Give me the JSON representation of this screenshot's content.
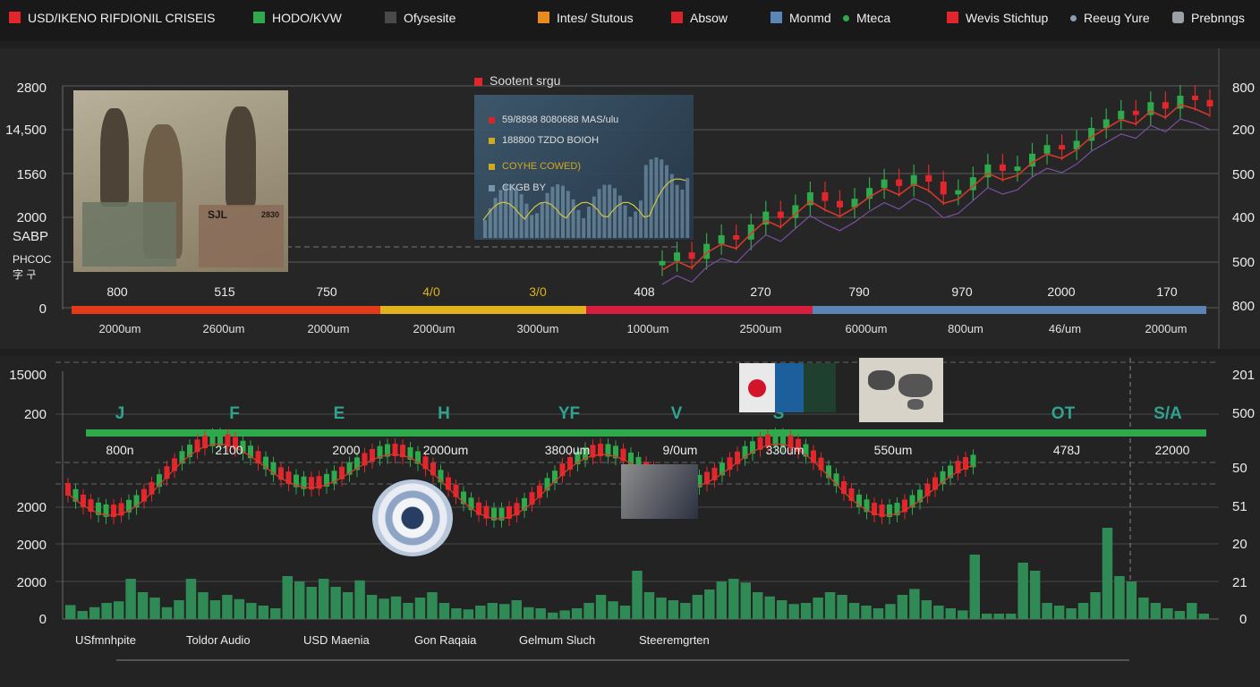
{
  "legend": [
    {
      "label": "USD/IKENO RIFDIONIL CRISEIS",
      "color": "#e3262b",
      "shape": "square"
    },
    {
      "label": "HODO/KVW",
      "color": "#2eaa4c",
      "shape": "square"
    },
    {
      "label": "Ofysesite",
      "color": "#4a4a4a",
      "shape": "square"
    },
    {
      "label": "Intes/ Stutous",
      "color": "#e88a1c",
      "shape": "square"
    },
    {
      "label": "Absow",
      "color": "#d8232a",
      "shape": "square"
    },
    {
      "label": "Monmd",
      "color": "#5a86b8",
      "shape": "square"
    },
    {
      "label": "Mteca",
      "color": "#2eaa4c",
      "shape": "dot"
    },
    {
      "label": "Wevis Stichtup",
      "color": "#e3262b",
      "shape": "square"
    },
    {
      "label": "Reeug Yure",
      "color": "#8aa0b0",
      "shape": "dot"
    },
    {
      "label": "Prebnngs",
      "color": "#9aa0a8",
      "shape": "icon"
    }
  ],
  "colors": {
    "up": "#2eaa4c",
    "down": "#e3262b",
    "volume": "#2f8a55",
    "segment_red": "#e33a1c",
    "segment_yellow": "#e0b21d",
    "segment_pink": "#d71e3e",
    "segment_blue": "#5b84b5"
  },
  "top_panel": {
    "left_axis": [
      "2800",
      "14,500",
      "1560",
      "2000",
      "0"
    ],
    "side_labels": [
      "SABP",
      "PHCOC",
      "字 구"
    ],
    "right_axis": [
      "800",
      "200",
      "500",
      "400",
      "500",
      "800"
    ],
    "x_labels": [
      "800",
      "515",
      "750",
      "4/0",
      "3/0",
      "408",
      "270",
      "790",
      "970",
      "2000",
      "170"
    ],
    "bottom_labels": [
      "2000um",
      "2600um",
      "2000um",
      "2000um",
      "3000um",
      "1000um",
      "2500um",
      "6000um",
      "800um",
      "46/um",
      "2000um"
    ],
    "inset_title": "Sootent srgu",
    "inset_rows": [
      {
        "text": "59/8898   8080688   MAS/ulu",
        "color": "#e3262b"
      },
      {
        "text": "188800   TZDO  BOIOH",
        "color": "#e0b21d"
      },
      {
        "text": "COYHE COWED)",
        "color": "#e0b21d"
      },
      {
        "text": "CKGB BY",
        "color": "#7a9fb8"
      }
    ],
    "photo_notes": [
      "SJL",
      "2830"
    ]
  },
  "bottom_panel": {
    "left_axis": [
      "15000",
      "200",
      "2000",
      "2000",
      "2000",
      "0"
    ],
    "right_axis": [
      "201",
      "500",
      "50",
      "51",
      "20",
      "21",
      "0"
    ],
    "letters": [
      "J",
      "F",
      "E",
      "H",
      "YF",
      "V",
      "S",
      "OT",
      "S/A"
    ],
    "row_labels": [
      "800n",
      "2100",
      "2000",
      "2000um",
      "3800um",
      "9/0um",
      "330um",
      "550um",
      "478J",
      "22000"
    ],
    "x_labels": [
      "USfmnhpite",
      "Toldor Audio",
      "USD Maenia",
      "Gon Raqaia",
      "Gelmum Sluch",
      "Steeremgrten"
    ]
  },
  "chart_data": [
    {
      "type": "candlestick",
      "panel": "top",
      "series": [
        {
          "name": "",
          "values": [
            0.18,
            0.22,
            0.19,
            0.26,
            0.3,
            0.28,
            0.35,
            0.41,
            0.38,
            0.44,
            0.5,
            0.46,
            0.43,
            0.47,
            0.52,
            0.56,
            0.53,
            0.58,
            0.55,
            0.49,
            0.51,
            0.57,
            0.63,
            0.6,
            0.62,
            0.68,
            0.72,
            0.7,
            0.74,
            0.8,
            0.84,
            0.88,
            0.86,
            0.92,
            0.89,
            0.95,
            0.93,
            0.9
          ]
        }
      ]
    },
    {
      "type": "bar",
      "panel": "bottom-volume",
      "values": [
        0.26,
        0.15,
        0.22,
        0.3,
        0.33,
        0.75,
        0.5,
        0.4,
        0.22,
        0.35,
        0.75,
        0.5,
        0.35,
        0.45,
        0.37,
        0.3,
        0.25,
        0.2,
        0.8,
        0.7,
        0.6,
        0.75,
        0.6,
        0.5,
        0.72,
        0.45,
        0.38,
        0.42,
        0.3,
        0.4,
        0.5,
        0.3,
        0.2,
        0.18,
        0.25,
        0.3,
        0.28,
        0.35,
        0.22,
        0.2,
        0.12,
        0.16,
        0.2,
        0.3,
        0.45,
        0.33,
        0.25,
        0.9,
        0.5,
        0.4,
        0.35,
        0.3,
        0.45,
        0.55,
        0.7,
        0.75,
        0.68,
        0.5,
        0.42,
        0.35,
        0.28,
        0.3,
        0.4,
        0.5,
        0.45,
        0.3,
        0.25,
        0.2,
        0.28,
        0.45,
        0.56,
        0.35,
        0.25,
        0.2,
        0.16,
        1.2,
        0.1,
        0.1,
        0.1,
        1.05,
        0.9,
        0.3,
        0.25,
        0.2,
        0.3,
        0.5,
        1.7,
        0.8,
        0.7,
        0.4,
        0.3,
        0.2,
        0.15,
        0.3,
        0.1
      ]
    }
  ]
}
